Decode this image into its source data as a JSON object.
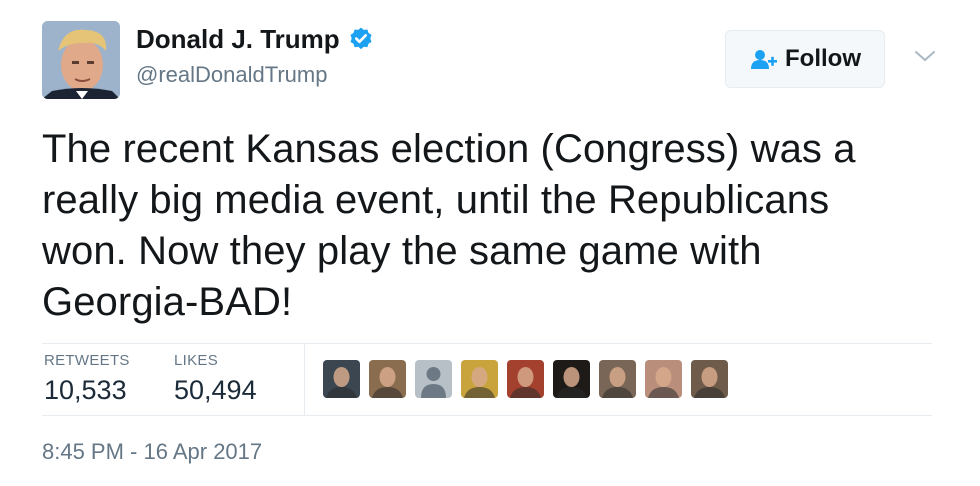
{
  "user": {
    "name": "Donald J. Trump",
    "handle": "@realDonaldTrump",
    "verified": true
  },
  "header": {
    "follow_label": "Follow"
  },
  "tweet": {
    "lines": [
      "The recent Kansas election (Congress) was a",
      "really big media event, until the Republicans",
      "won. Now they play the same game with",
      "Georgia-BAD!"
    ]
  },
  "stats": {
    "retweets_label": "RETWEETS",
    "retweets_value": "10,533",
    "likes_label": "LIKES",
    "likes_value": "50,494"
  },
  "likers": [
    {
      "icon": "liker-avatar-1",
      "color": "#3b4650"
    },
    {
      "icon": "liker-avatar-2",
      "color": "#8a6c4e"
    },
    {
      "icon": "liker-avatar-default",
      "color": "#b7c0c7"
    },
    {
      "icon": "liker-avatar-4",
      "color": "#c9a43c"
    },
    {
      "icon": "liker-avatar-5",
      "color": "#a3402e"
    },
    {
      "icon": "liker-avatar-6",
      "color": "#1e1a18"
    },
    {
      "icon": "liker-avatar-7",
      "color": "#7a6656"
    },
    {
      "icon": "liker-avatar-8",
      "color": "#b98f7c"
    },
    {
      "icon": "liker-avatar-9",
      "color": "#6e5b49"
    }
  ],
  "meta": {
    "timestamp": "8:45 PM - 16 Apr 2017"
  },
  "colors": {
    "verified_blue": "#1da1f2",
    "text": "#14171a",
    "muted": "#657786"
  }
}
